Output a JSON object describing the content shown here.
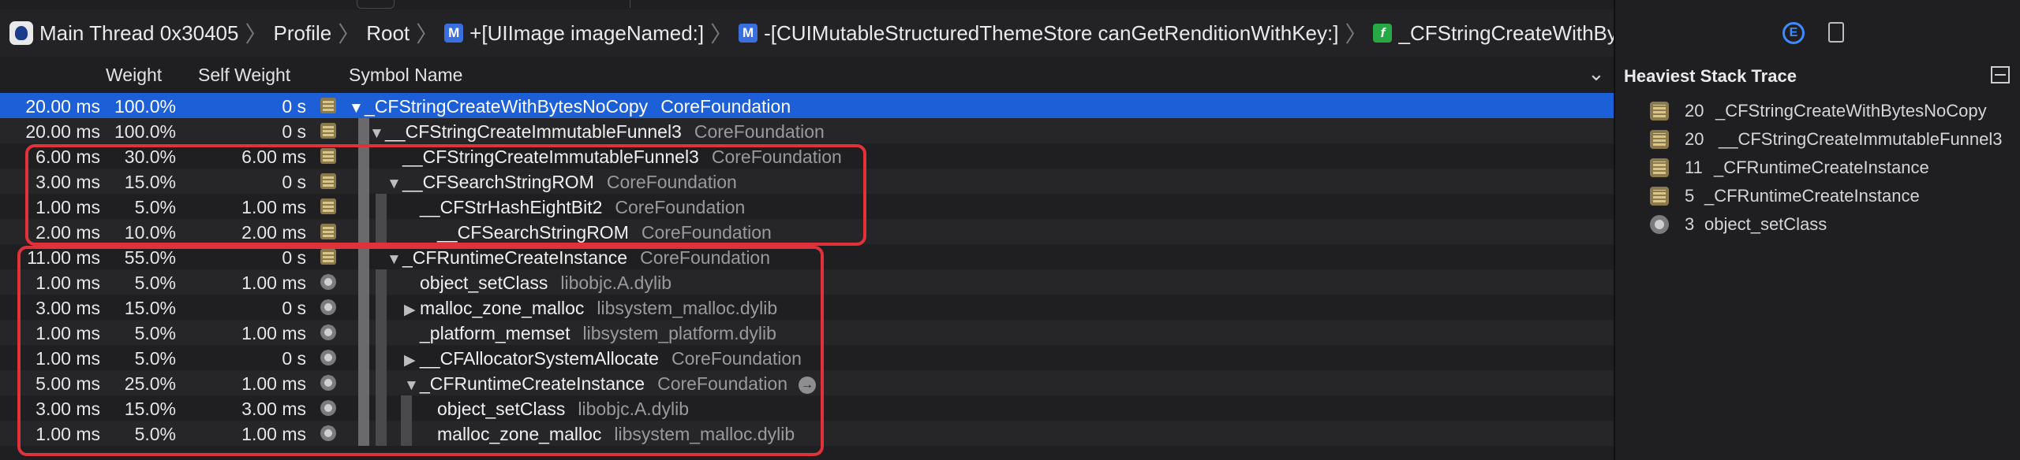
{
  "breadcrumb": {
    "items": [
      {
        "label": "Main Thread  0x30405",
        "icon": "thread-icon"
      },
      {
        "label": "Profile",
        "icon": ""
      },
      {
        "label": "Root",
        "icon": ""
      },
      {
        "label": "+[UIImage imageNamed:]",
        "icon": "M"
      },
      {
        "label": "-[CUIMutableStructuredThemeStore canGetRenditionWithKey:]",
        "icon": "M"
      },
      {
        "label": "_CFStringCreateWithBytesNoCopy",
        "icon": "f"
      }
    ],
    "separator": "〉"
  },
  "columns": {
    "weight": "Weight",
    "self_weight": "Self Weight",
    "symbol_name": "Symbol Name",
    "chevron": "⌄"
  },
  "rows": [
    {
      "weight_ms": "20.00 ms",
      "weight_pct": "100.0%",
      "self": "0 s",
      "kind": "sys",
      "depth": 0,
      "disclosure": "▼",
      "name": "_CFStringCreateWithBytesNoCopy",
      "lib": "CoreFoundation",
      "selected": true
    },
    {
      "weight_ms": "20.00 ms",
      "weight_pct": "100.0%",
      "self": "0 s",
      "kind": "sys",
      "depth": 1,
      "disclosure": "▼",
      "name": "__CFStringCreateImmutableFunnel3",
      "lib": "CoreFoundation"
    },
    {
      "weight_ms": "6.00 ms",
      "weight_pct": "30.0%",
      "self": "6.00 ms",
      "kind": "sys",
      "depth": 2,
      "disclosure": "",
      "name": "__CFStringCreateImmutableFunnel3",
      "lib": "CoreFoundation"
    },
    {
      "weight_ms": "3.00 ms",
      "weight_pct": "15.0%",
      "self": "0 s",
      "kind": "sys",
      "depth": 2,
      "disclosure": "▼",
      "name": "__CFSearchStringROM",
      "lib": "CoreFoundation"
    },
    {
      "weight_ms": "1.00 ms",
      "weight_pct": "5.0%",
      "self": "1.00 ms",
      "kind": "sys",
      "depth": 3,
      "disclosure": "",
      "name": "__CFStrHashEightBit2",
      "lib": "CoreFoundation"
    },
    {
      "weight_ms": "2.00 ms",
      "weight_pct": "10.0%",
      "self": "2.00 ms",
      "kind": "sys",
      "depth": 3,
      "disclosure": "",
      "name": "__CFSearchStringROM",
      "lib": "CoreFoundation",
      "indent_extra": true
    },
    {
      "weight_ms": "11.00 ms",
      "weight_pct": "55.0%",
      "self": "0 s",
      "kind": "sys",
      "depth": 2,
      "disclosure": "▼",
      "name": "_CFRuntimeCreateInstance",
      "lib": "CoreFoundation"
    },
    {
      "weight_ms": "1.00 ms",
      "weight_pct": "5.0%",
      "self": "1.00 ms",
      "kind": "user",
      "depth": 3,
      "disclosure": "",
      "name": "object_setClass",
      "lib": "libobjc.A.dylib"
    },
    {
      "weight_ms": "3.00 ms",
      "weight_pct": "15.0%",
      "self": "0 s",
      "kind": "user",
      "depth": 3,
      "disclosure": "▶",
      "name": "malloc_zone_malloc",
      "lib": "libsystem_malloc.dylib"
    },
    {
      "weight_ms": "1.00 ms",
      "weight_pct": "5.0%",
      "self": "1.00 ms",
      "kind": "user",
      "depth": 3,
      "disclosure": "",
      "name": "_platform_memset",
      "lib": "libsystem_platform.dylib"
    },
    {
      "weight_ms": "1.00 ms",
      "weight_pct": "5.0%",
      "self": "0 s",
      "kind": "user",
      "depth": 3,
      "disclosure": "▶",
      "name": "__CFAllocatorSystemAllocate",
      "lib": "CoreFoundation"
    },
    {
      "weight_ms": "5.00 ms",
      "weight_pct": "25.0%",
      "self": "1.00 ms",
      "kind": "user",
      "depth": 3,
      "disclosure": "▼",
      "name": "_CFRuntimeCreateInstance",
      "lib": "CoreFoundation",
      "goto": true
    },
    {
      "weight_ms": "3.00 ms",
      "weight_pct": "15.0%",
      "self": "3.00 ms",
      "kind": "user",
      "depth": 4,
      "disclosure": "",
      "name": "object_setClass",
      "lib": "libobjc.A.dylib"
    },
    {
      "weight_ms": "1.00 ms",
      "weight_pct": "5.0%",
      "self": "1.00 ms",
      "kind": "user",
      "depth": 4,
      "disclosure": "",
      "name": "malloc_zone_malloc",
      "lib": "libsystem_malloc.dylib"
    }
  ],
  "inspector": {
    "title": "Heaviest Stack Trace",
    "tab_extended_label": "E",
    "stack": [
      {
        "count": "20",
        "name": "_CFStringCreateWithBytesNoCopy",
        "kind": "sys"
      },
      {
        "count": "20",
        "name": "__CFStringCreateImmutableFunnel3",
        "kind": "sys"
      },
      {
        "count": "11",
        "name": "_CFRuntimeCreateInstance",
        "kind": "sys"
      },
      {
        "count": "5",
        "name": "_CFRuntimeCreateInstance",
        "kind": "sys"
      },
      {
        "count": "3",
        "name": "object_setClass",
        "kind": "user"
      }
    ]
  },
  "colors": {
    "selection": "#1c5fd6",
    "annotation": "#e0323b",
    "background": "#1f1f21"
  }
}
